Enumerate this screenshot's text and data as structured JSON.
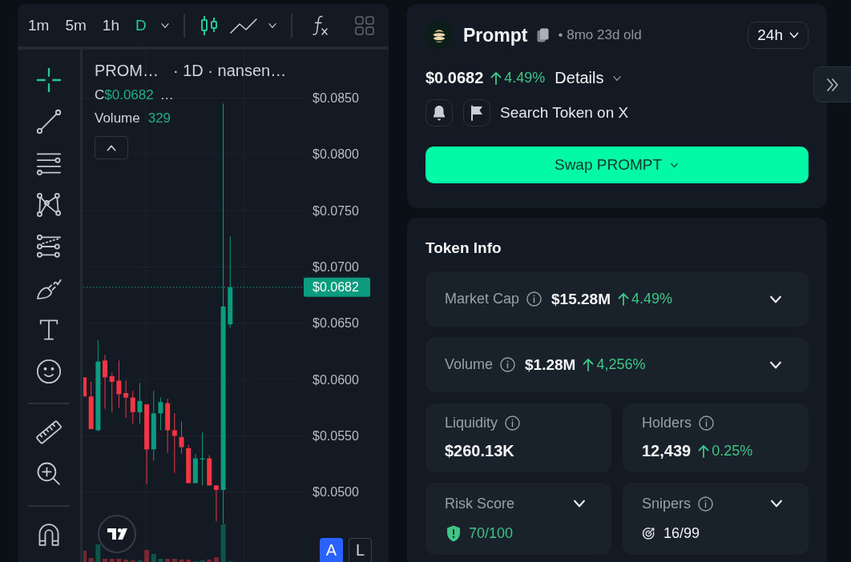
{
  "chart_panel": {
    "timeframes": [
      {
        "label": "1m",
        "selected": false
      },
      {
        "label": "5m",
        "selected": false
      },
      {
        "label": "1h",
        "selected": false
      },
      {
        "label": "D",
        "selected": true
      }
    ],
    "chart_types": [
      {
        "kind": "candles",
        "selected": true
      },
      {
        "kind": "line",
        "selected": false
      }
    ],
    "drawing_tool_groups": [
      {
        "tools": [
          {
            "kind": "crosshair",
            "selected": true
          },
          {
            "kind": "trend-line",
            "selected": false
          },
          {
            "kind": "horizontal-lines",
            "selected": false
          },
          {
            "kind": "pattern",
            "selected": false
          },
          {
            "kind": "projection",
            "selected": false
          },
          {
            "kind": "brush",
            "selected": false
          },
          {
            "kind": "text",
            "selected": false
          },
          {
            "kind": "emoji",
            "selected": false
          }
        ]
      },
      {
        "tools": [
          {
            "kind": "ruler",
            "selected": false
          },
          {
            "kind": "zoom-in",
            "selected": false
          }
        ]
      },
      {
        "tools": [
          {
            "kind": "magnet",
            "selected": false
          }
        ]
      }
    ],
    "legend": {
      "symbol": "PROM…",
      "interval": "· 1D · nansen…",
      "close_label": "C",
      "close_value": "$0.0682",
      "more": "…",
      "volume_label": "Volume",
      "volume_value": "329"
    },
    "price_axis": {
      "labels": [
        "$0.0850",
        "$0.0800",
        "$0.0750",
        "$0.0700",
        "$0.0650",
        "$0.0600",
        "$0.0550",
        "$0.0500"
      ],
      "current_price": "$0.0682"
    },
    "scale_buttons": [
      {
        "label": "A",
        "selected": true
      },
      {
        "label": "L",
        "selected": false
      }
    ]
  },
  "token": {
    "name": "Prompt",
    "age": "• 8mo 23d old",
    "period": "24h",
    "price": "$0.0682",
    "change": {
      "value": "4.49%",
      "rising": true
    },
    "details": "Details",
    "search_link": "Search Token on X",
    "swap": "Swap PROMPT"
  },
  "token_info": {
    "title": "Token Info",
    "rows": [
      {
        "label": "Market Cap",
        "info": true,
        "value": "$15.28M",
        "change": {
          "value": "4.49%",
          "rising": true
        },
        "expanded": false
      },
      {
        "label": "Volume",
        "info": true,
        "value": "$1.28M",
        "change": {
          "value": "4,256%",
          "rising": true
        },
        "expanded": false
      }
    ],
    "cards": [
      {
        "kind": "plain",
        "label": "Liquidity",
        "info": true,
        "value": "$260.13K"
      },
      {
        "kind": "plain",
        "label": "Holders",
        "info": true,
        "value": "12,439",
        "change": {
          "value": "0.25%",
          "rising": true
        }
      },
      {
        "kind": "risk",
        "label": "Risk Score",
        "info": false,
        "expanded": false,
        "value": "70/100"
      },
      {
        "kind": "snipers",
        "label": "Snipers",
        "info": true,
        "expanded": false,
        "value": "16/99"
      }
    ]
  }
}
